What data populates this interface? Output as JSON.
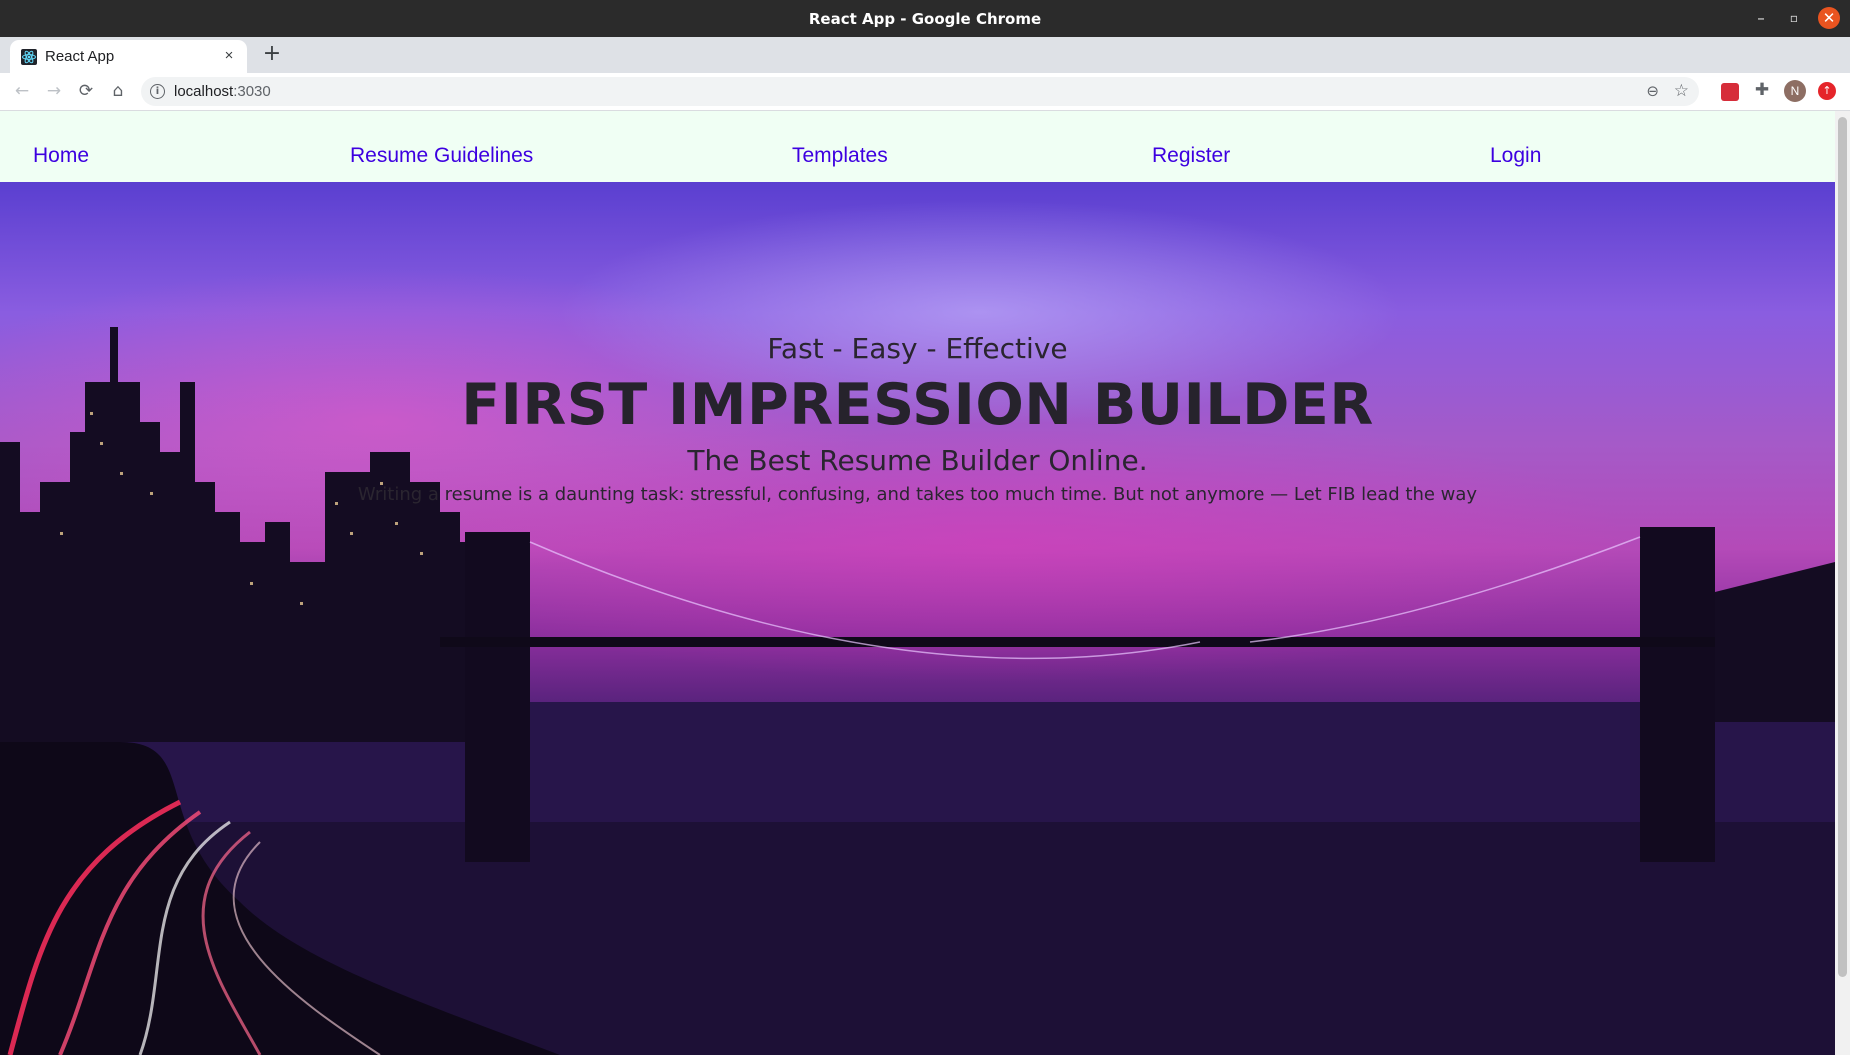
{
  "window": {
    "title": "React App - Google Chrome",
    "controls": {
      "minimize": "–",
      "maximize": "▫",
      "close": "✕"
    }
  },
  "browser": {
    "tab": {
      "label": "React App",
      "favicon": "react-icon",
      "close_glyph": "×"
    },
    "new_tab_glyph": "+",
    "toolbar": {
      "back_glyph": "←",
      "forward_glyph": "→",
      "reload_glyph": "⟳",
      "home_glyph": "⌂",
      "address_host": "localhost",
      "address_port": ":3030",
      "info_glyph": "i",
      "zoom_glyph": "⊖",
      "bookmark_glyph": "☆",
      "extensions_glyph": "✚",
      "profile_initial": "N",
      "update_glyph": "↑"
    }
  },
  "navbar": {
    "links": [
      {
        "label": "Home"
      },
      {
        "label": "Resume Guidelines"
      },
      {
        "label": "Templates"
      },
      {
        "label": "Register"
      },
      {
        "label": "Login"
      }
    ],
    "background": "#f0fff4",
    "link_color": "#3d00e0"
  },
  "hero": {
    "tagline": "Fast - Easy - Effective",
    "title": "FIRST IMPRESSION BUILDER",
    "subtitle": "The Best Resume Builder Online.",
    "description": "Writing a resume is a daunting task: stressful, confusing, and takes too much time. But not anymore — Let FIB lead the way",
    "background_image": "city-skyline-bridge-sunset"
  }
}
